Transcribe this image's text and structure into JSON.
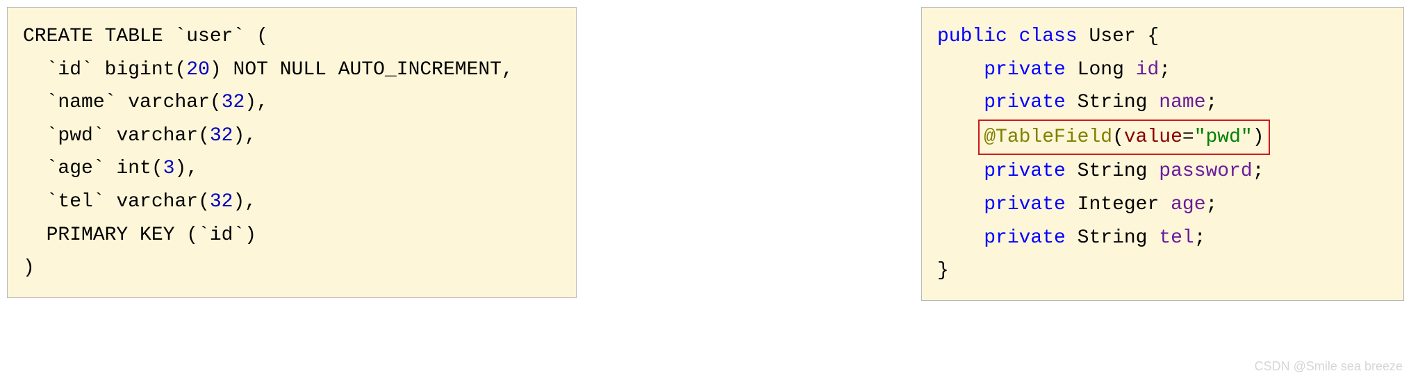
{
  "sql": {
    "line1_create": "CREATE TABLE",
    "line1_tbl": "`user`",
    "line1_paren": "(",
    "line2_col": "`id`",
    "line2_type": "bigint",
    "line2_lp": "(",
    "line2_num": "20",
    "line2_rp": ")",
    "line2_nn": "NOT NULL",
    "line2_ai": "AUTO_INCREMENT",
    "line2_comma": ",",
    "line3_col": "`name`",
    "line3_type": "varchar",
    "line3_lp": "(",
    "line3_num": "32",
    "line3_rp": ")",
    "line3_comma": ",",
    "line4_col": "`pwd`",
    "line4_type": "varchar",
    "line4_lp": "(",
    "line4_num": "32",
    "line4_rp": ")",
    "line4_comma": ",",
    "line5_col": "`age`",
    "line5_type": "int",
    "line5_lp": "(",
    "line5_num": "3",
    "line5_rp": ")",
    "line5_comma": ",",
    "line6_col": "`tel`",
    "line6_type": "varchar",
    "line6_lp": "(",
    "line6_num": "32",
    "line6_rp": ")",
    "line6_comma": ",",
    "line7_pk": "PRIMARY KEY",
    "line7_lp": "(",
    "line7_col": "`id`",
    "line7_rp": ")",
    "line8_close": ")"
  },
  "java": {
    "public": "public",
    "class": "class",
    "classname": "User",
    "obrace": "{",
    "private": "private",
    "Long": "Long",
    "String": "String",
    "Integer": "Integer",
    "id": "id",
    "name": "name",
    "password": "password",
    "age": "age",
    "tel": "tel",
    "semi": ";",
    "anno_at": "@TableField",
    "anno_lp": "(",
    "anno_key": "value",
    "anno_eq": "=",
    "anno_val": "\"pwd\"",
    "anno_rp": ")",
    "cbrace": "}"
  },
  "watermark": "CSDN @Smile sea breeze"
}
